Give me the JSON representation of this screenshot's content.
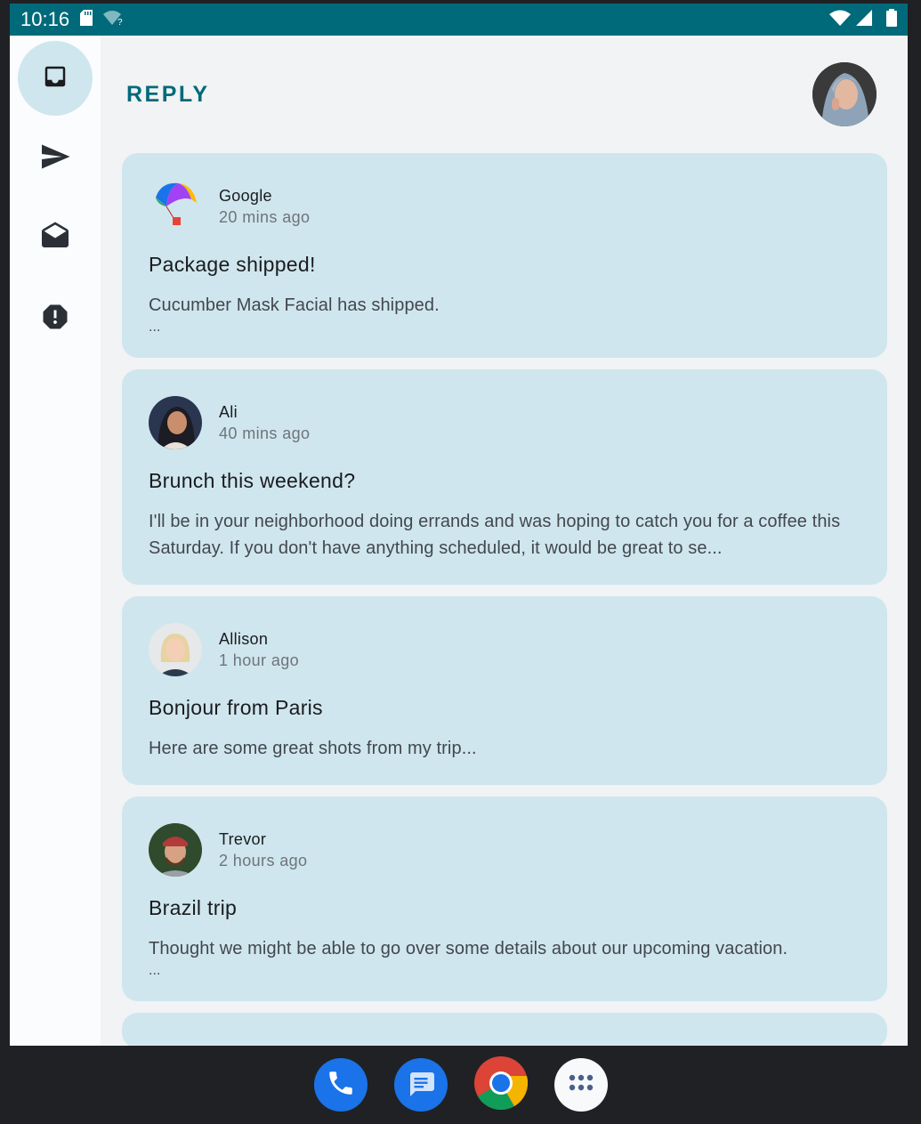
{
  "status_bar": {
    "time": "10:16",
    "icons": [
      "sd-card-icon",
      "wifi-unknown-icon",
      "wifi-icon",
      "signal-icon",
      "battery-icon"
    ]
  },
  "app": {
    "title": "REPLY",
    "accent": "#006a7a",
    "card_color": "#cfe6ee"
  },
  "rail": {
    "items": [
      {
        "icon": "inbox-icon",
        "active": true
      },
      {
        "icon": "send-icon",
        "active": false
      },
      {
        "icon": "drafts-icon",
        "active": false
      },
      {
        "icon": "report-icon",
        "active": false
      }
    ]
  },
  "emails": [
    {
      "sender": "Google",
      "time": "20 mins ago",
      "subject": "Package shipped!",
      "preview": "Cucumber Mask Facial has shipped.",
      "more": "..."
    },
    {
      "sender": "Ali",
      "time": "40 mins ago",
      "subject": "Brunch this weekend?",
      "preview": "I'll be in your neighborhood doing errands and was hoping to catch you for a coffee this Saturday. If you don't have anything scheduled, it would be great to se..."
    },
    {
      "sender": "Allison",
      "time": "1 hour ago",
      "subject": "Bonjour from Paris",
      "preview": "Here are some great shots from my trip..."
    },
    {
      "sender": "Trevor",
      "time": "2 hours ago",
      "subject": "Brazil trip",
      "preview": "Thought we might be able to go over some details about our upcoming vacation.",
      "more": "..."
    }
  ],
  "dock": {
    "apps": [
      "phone-icon",
      "messages-icon",
      "chrome-icon",
      "app-drawer-icon"
    ]
  }
}
